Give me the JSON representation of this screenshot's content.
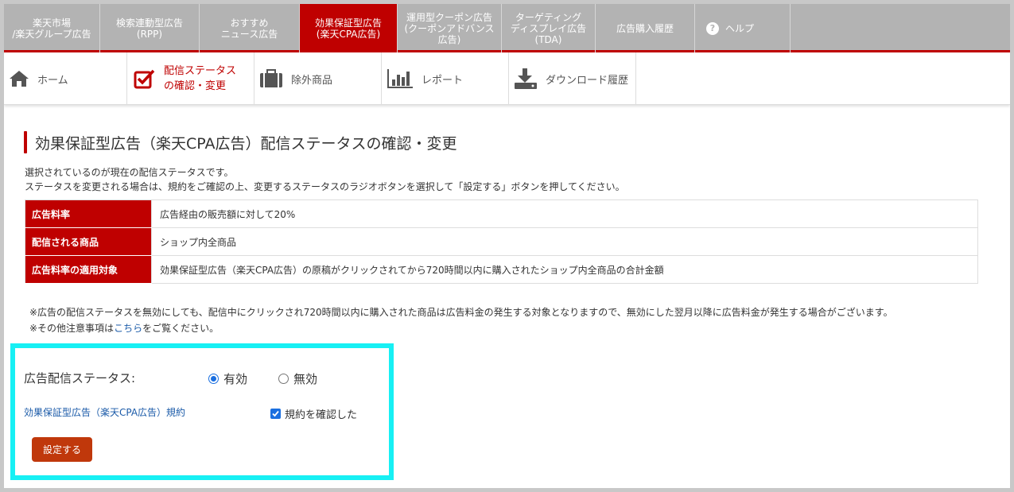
{
  "top_tabs": [
    {
      "label": "楽天市場\n/楽天グループ広告",
      "width": 121
    },
    {
      "label": "検索連動型広告\n(RPP)",
      "width": 125
    },
    {
      "label": "おすすめ\nニュース広告",
      "width": 126
    },
    {
      "label": "効果保証型広告\n(楽天CPA広告)",
      "width": 123,
      "active": true
    },
    {
      "label": "運用型クーポン広告\n(クーポンアドバンス\n広告)",
      "width": 131
    },
    {
      "label": "ターゲティング\nディスプレイ広告\n(TDA)",
      "width": 118
    },
    {
      "label": "広告購入履歴",
      "width": 125
    }
  ],
  "help": {
    "label": "ヘルプ",
    "icon": "question-circle-icon"
  },
  "sub_nav": [
    {
      "label": "ホーム",
      "icon": "home-icon"
    },
    {
      "label_1": "配信ステータス",
      "label_2": "の確認・変更",
      "icon": "checkbox-check-icon",
      "active": true
    },
    {
      "label": "除外商品",
      "icon": "briefcase-icon"
    },
    {
      "label": "レポート",
      "icon": "bar-chart-icon"
    },
    {
      "label": "ダウンロード履歴",
      "icon": "download-icon"
    }
  ],
  "page": {
    "title": "効果保証型広告（楽天CPA広告）配信ステータスの確認・変更",
    "desc_1": "選択されているのが現在の配信ステータスです。",
    "desc_2": "ステータスを変更される場合は、規約をご確認の上、変更するステータスのラジオボタンを選択して「設定する」ボタンを押してください。"
  },
  "info_table": [
    {
      "header": "広告料率",
      "value": "広告経由の販売額に対して20%"
    },
    {
      "header": "配信される商品",
      "value": "ショップ内全商品"
    },
    {
      "header": "広告料率の適用対象",
      "value": "効果保証型広告（楽天CPA広告）の原稿がクリックされてから720時間以内に購入されたショップ内全商品の合計金額"
    }
  ],
  "notes": {
    "line_1": "※広告の配信ステータスを無効にしても、配信中にクリックされ720時間以内に購入された商品は広告料金の発生する対象となりますので、無効にした翌月以降に広告料金が発生する場合がございます。",
    "line_2_prefix": "※その他注意事項は",
    "line_2_link": "こちら",
    "line_2_suffix": "をご覧ください。"
  },
  "form": {
    "status_label": "広告配信ステータス:",
    "option_on": "有効",
    "option_off": "無効",
    "selected": "有効",
    "terms_link": "効果保証型広告（楽天CPA広告）規約",
    "confirm_label": "規約を確認した",
    "confirm_checked": true,
    "submit_label": "設定する"
  },
  "colors": {
    "brand_red": "#bf0000",
    "highlight": "#17f0f4",
    "link": "#1a5aa8",
    "button": "#c0380b"
  }
}
